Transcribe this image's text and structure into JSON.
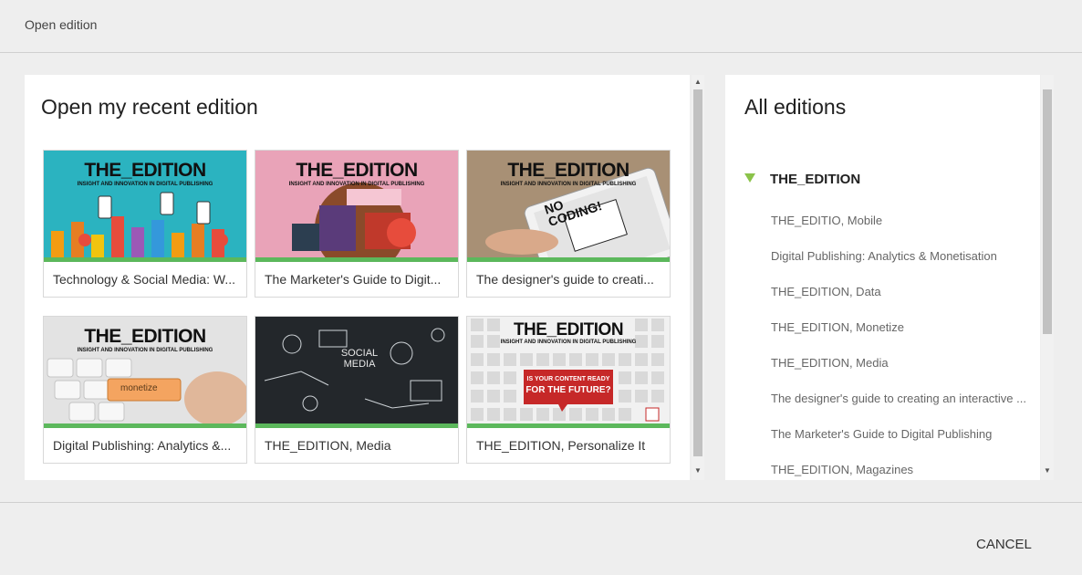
{
  "dialog": {
    "title": "Open edition",
    "cancel_label": "CANCEL"
  },
  "recent": {
    "heading": "Open my recent edition",
    "cards": [
      {
        "title": "Technology & Social Media: W..."
      },
      {
        "title": "The Marketer's Guide to Digit..."
      },
      {
        "title": "The designer's guide to creati..."
      },
      {
        "title": "Digital Publishing: Analytics &..."
      },
      {
        "title": "THE_EDITION, Media"
      },
      {
        "title": "THE_EDITION, Personalize It"
      }
    ],
    "thumb": {
      "logo": "THE_EDITION",
      "tagline": "INSIGHT AND INNOVATION IN DIGITAL PUBLISHING",
      "no_coding": "NO CODING!",
      "monetize": "monetize",
      "social_media": "SOCIAL MEDIA",
      "future_line1": "IS YOUR CONTENT READY",
      "future_line2": "FOR THE FUTURE?"
    }
  },
  "all": {
    "heading": "All editions",
    "root": "THE_EDITION",
    "items": [
      "THE_EDITIO, Mobile",
      "Digital Publishing: Analytics & Monetisation",
      "THE_EDITION, Data",
      "THE_EDITION, Monetize",
      "THE_EDITION, Media",
      "The designer's guide to creating an interactive ...",
      "The Marketer's Guide to Digital Publishing",
      "THE_EDITION, Magazines"
    ]
  },
  "colors": {
    "accent_green": "#5cb85c",
    "caret_green": "#8bc34a"
  }
}
